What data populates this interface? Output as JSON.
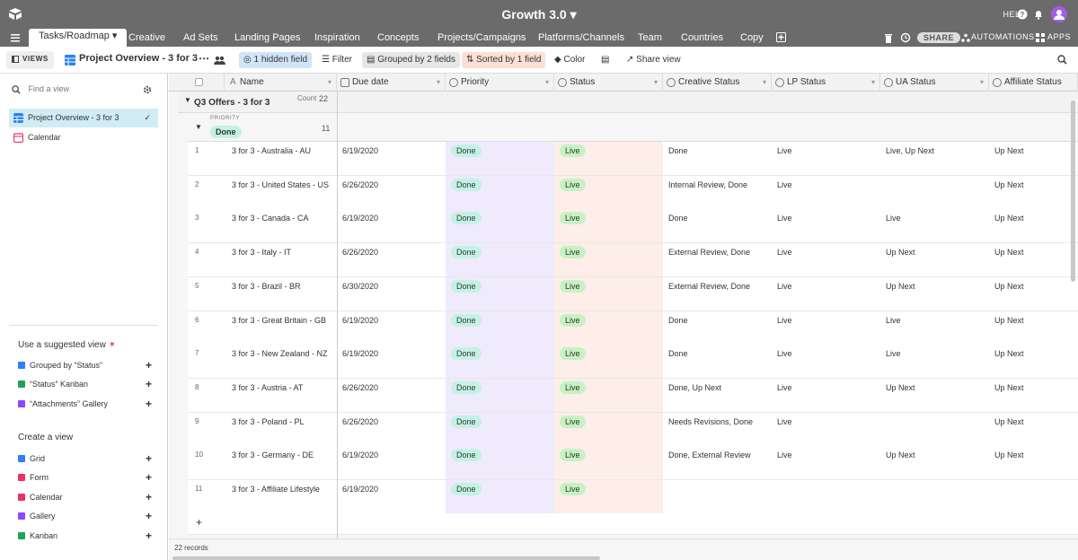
{
  "app": {
    "title": "Growth 3.0 ▾",
    "help": "HELP",
    "accent": "#2d7ff9"
  },
  "tabs": [
    {
      "label": "Tasks/Roadmap ▾",
      "active": true
    },
    {
      "label": "Creative"
    },
    {
      "label": "Ad Sets"
    },
    {
      "label": "Landing Pages"
    },
    {
      "label": "Inspiration"
    },
    {
      "label": "Concepts"
    },
    {
      "label": "Projects/Campaigns"
    },
    {
      "label": "Platforms/Channels"
    },
    {
      "label": "Team"
    },
    {
      "label": "Countries"
    },
    {
      "label": "Copy"
    }
  ],
  "tabbar_right": {
    "share": "SHARE",
    "automations": "AUTOMATIONS",
    "apps": "APPS"
  },
  "toolbar": {
    "views": "VIEWS",
    "view_title": "Project Overview - 3 for 3",
    "hidden": "1 hidden field",
    "filter": "Filter",
    "grouped": "Grouped by 2 fields",
    "sorted": "Sorted by 1 field",
    "color": "Color",
    "share_view": "Share view"
  },
  "sidebar": {
    "find_placeholder": "Find a view",
    "views": [
      {
        "label": "Project Overview - 3 for 3",
        "icon": "grid-icon",
        "active": true
      },
      {
        "label": "Calendar",
        "icon": "calendar-icon"
      }
    ],
    "suggested_title": "Use a suggested view",
    "suggested": [
      {
        "label": "Grouped by “Status”",
        "color": "#2d7ff9"
      },
      {
        "label": "“Status” Kanban",
        "color": "#20a05a"
      },
      {
        "label": "“Attachments” Gallery",
        "color": "#8b46ff"
      }
    ],
    "create_title": "Create a view",
    "create": [
      {
        "label": "Grid",
        "color": "#2d7ff9"
      },
      {
        "label": "Form",
        "color": "#ef3061"
      },
      {
        "label": "Calendar",
        "color": "#ef3061"
      },
      {
        "label": "Gallery",
        "color": "#8b46ff"
      },
      {
        "label": "Kanban",
        "color": "#20a05a"
      }
    ]
  },
  "columns": [
    "Name",
    "Due date",
    "Priority",
    "Status",
    "Creative Status",
    "LP Status",
    "UA Status",
    "Affiliate Status"
  ],
  "group1": {
    "title": "Q3 Offers - 3 for 3",
    "count_label": "Count",
    "count": "22"
  },
  "group2": {
    "label": "PRIORITY",
    "value": "Done",
    "count": "11"
  },
  "rows": [
    {
      "n": "1",
      "name": "3 for 3 - Australia - AU",
      "due": "6/19/2020",
      "priority": "Done",
      "status": "Live",
      "creative": "Done",
      "lp": "Live",
      "ua": "Live, Up Next",
      "aff": "Up Next"
    },
    {
      "n": "2",
      "name": "3 for 3 - United States - US",
      "due": "6/26/2020",
      "priority": "Done",
      "status": "Live",
      "creative": "Internal Review, Done",
      "lp": "Live",
      "ua": "",
      "aff": "Up Next"
    },
    {
      "n": "3",
      "name": "3 for 3 - Canada - CA",
      "due": "6/19/2020",
      "priority": "Done",
      "status": "Live",
      "creative": "Done",
      "lp": "Live",
      "ua": "Live",
      "aff": "Up Next"
    },
    {
      "n": "4",
      "name": "3 for 3 - Italy - IT",
      "due": "6/26/2020",
      "priority": "Done",
      "status": "Live",
      "creative": "External Review, Done",
      "lp": "Live",
      "ua": "Up Next",
      "aff": "Up Next"
    },
    {
      "n": "5",
      "name": "3 for 3 - Brazil - BR",
      "due": "6/30/2020",
      "priority": "Done",
      "status": "Live",
      "creative": "External Review, Done",
      "lp": "Live",
      "ua": "Up Next",
      "aff": "Up Next"
    },
    {
      "n": "6",
      "name": "3 for 3 - Great Britain - GB",
      "due": "6/19/2020",
      "priority": "Done",
      "status": "Live",
      "creative": "Done",
      "lp": "Live",
      "ua": "Live",
      "aff": "Up Next"
    },
    {
      "n": "7",
      "name": "3 for 3 - New Zealand - NZ",
      "due": "6/19/2020",
      "priority": "Done",
      "status": "Live",
      "creative": "Done",
      "lp": "Live",
      "ua": "Live",
      "aff": "Up Next"
    },
    {
      "n": "8",
      "name": "3 for 3 - Austria - AT",
      "due": "6/26/2020",
      "priority": "Done",
      "status": "Live",
      "creative": "Done, Up Next",
      "lp": "Live",
      "ua": "Up Next",
      "aff": "Up Next"
    },
    {
      "n": "9",
      "name": "3 for 3 - Poland - PL",
      "due": "6/26/2020",
      "priority": "Done",
      "status": "Live",
      "creative": "Needs Revisions, Done",
      "lp": "Live",
      "ua": "",
      "aff": "Up Next"
    },
    {
      "n": "10",
      "name": "3 for 3 - Germany - DE",
      "due": "6/19/2020",
      "priority": "Done",
      "status": "Live",
      "creative": "Done, External Review",
      "lp": "Live",
      "ua": "Up Next",
      "aff": "Up Next"
    },
    {
      "n": "11",
      "name": "3 for 3 - Affiliate Lifestyle",
      "due": "6/19/2020",
      "priority": "Done",
      "status": "Live",
      "creative": "",
      "lp": "",
      "ua": "",
      "aff": ""
    }
  ],
  "add_row": "+",
  "footer": "22 records"
}
